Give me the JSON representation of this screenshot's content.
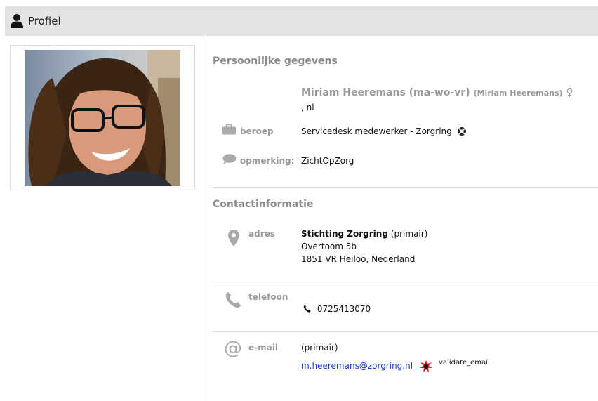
{
  "header": {
    "title": "Profiel",
    "icon": "user-icon"
  },
  "personal": {
    "section_title": "Persoonlijke gegevens",
    "name": "Miriam Heeremans (ma-wo-vr)",
    "name_alias": "(Miriam Heeremans)",
    "gender_symbol": "♀",
    "locale": ", nl",
    "occupation_label": "beroep",
    "occupation_value": "Servicedesk medewerker - Zorgring",
    "remark_label": "opmerking:",
    "remark_value": "ZichtOpZorg"
  },
  "contact": {
    "section_title": "Contactinformatie",
    "address_label": "adres",
    "address_org": "Stichting Zorgring",
    "address_primary": "(primair)",
    "address_street": "Overtoom 5b",
    "address_city": "1851 VR Heiloo, Nederland",
    "phone_label": "telefoon",
    "phone_value": "0725413070",
    "email_label": "e-mail",
    "email_primary": "(primair)",
    "email_value": "m.heeremans@zorgring.nl",
    "validate_text": "validate_email"
  },
  "colors": {
    "header_bg": "#e3e3e3",
    "label_gray": "#9a9a9a",
    "link_blue": "#1a3fbf",
    "badge_red": "#d61a1a"
  }
}
